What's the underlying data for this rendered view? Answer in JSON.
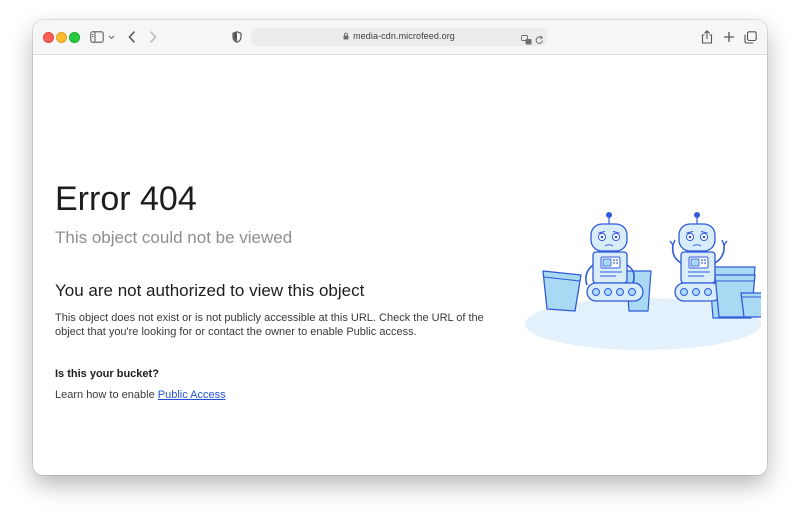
{
  "browser": {
    "url": "media-cdn.microfeed.org",
    "icons": {
      "close": "close-window-button",
      "minimize": "minimize-window-button",
      "zoom": "zoom-window-button",
      "sidebar": "sidebar-icon",
      "back": "chevron-left-icon",
      "forward": "chevron-right-icon",
      "privacy": "shield-icon",
      "lock": "lock-icon",
      "translate": "translate-icon",
      "reload": "reload-icon",
      "share": "share-icon",
      "new_tab": "plus-icon",
      "tabs": "tab-overview-icon"
    }
  },
  "page": {
    "title": "Error 404",
    "subtitle": "This object could not be viewed",
    "heading": "You are not authorized to view this object",
    "description": "This object does not exist or is not publicly accessible at this URL. Check the URL of the object that you're looking for or contact the owner to enable Public access.",
    "bucket_question": "Is this your bucket?",
    "learn_prefix": "Learn how to enable ",
    "learn_link": "Public Access"
  },
  "colors": {
    "title": "#1d1d1d",
    "subtitle": "#8e8e8e",
    "link": "#2152d9",
    "robot_outline": "#2f5ad9",
    "robot_fill": "#d8ecfa",
    "bucket_fill": "#a9d9f3",
    "floor": "#e2f1fb"
  }
}
